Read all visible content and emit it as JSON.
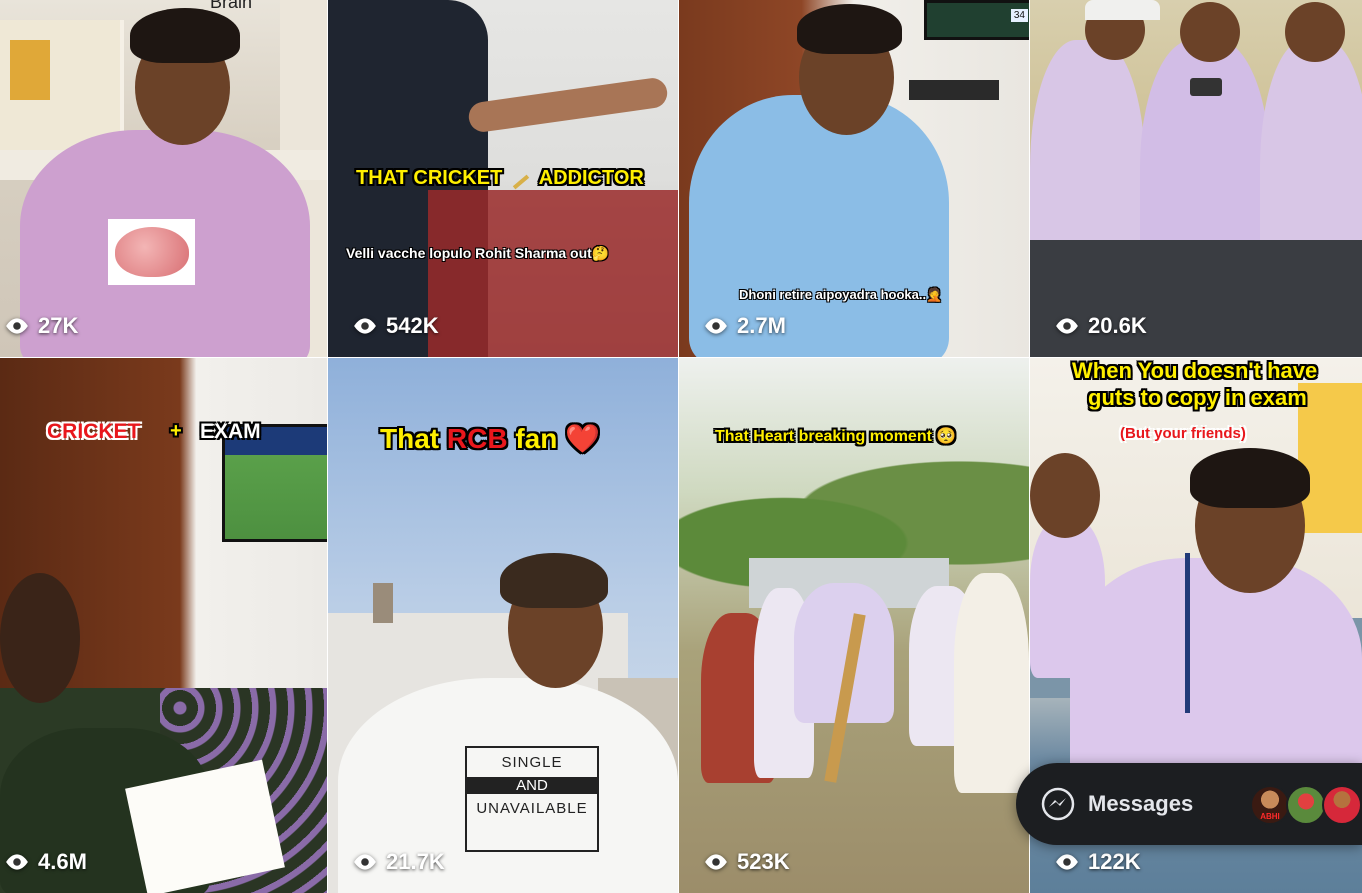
{
  "tiles": [
    {
      "views": "27K",
      "caption": "Brain"
    },
    {
      "views": "542K",
      "caption": "THAT CRICKET",
      "caption2": "ADDICTOR",
      "subtitle": "Velli vacche lopulo Rohit Sharma out🤔"
    },
    {
      "views": "2.7M",
      "subtitle": "Dhoni retire aipoyadra hooka..🤦"
    },
    {
      "views": "20.6K"
    },
    {
      "views": "4.6M",
      "caption_left": "CRICKET",
      "caption_plus": "+",
      "caption_right": "EXAM"
    },
    {
      "views": "21.7K",
      "caption_a": "That",
      "caption_b": "RCB",
      "caption_c": "fan",
      "caption_heart": "❤️",
      "shirt_line1": "SINGLE",
      "shirt_line2": "AND",
      "shirt_line3": "UNAVAILABLE"
    },
    {
      "views": "523K",
      "caption": "That Heart breaking moment 🥺"
    },
    {
      "views": "122K",
      "caption_line1": "When You doesn't have",
      "caption_line2": "guts to copy in exam",
      "caption_sub": "(But your friends)"
    }
  ],
  "tv_score": "34",
  "messages": {
    "label": "Messages",
    "avatar_label": "ABHI"
  },
  "icons": {
    "views": "eye-icon",
    "messenger": "messenger-icon"
  }
}
